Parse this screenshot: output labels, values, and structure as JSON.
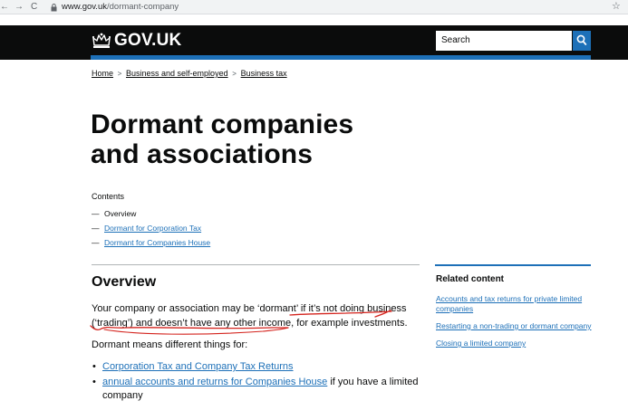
{
  "browser": {
    "back_icon": "←",
    "forward_icon": "→",
    "reload_icon": "C",
    "url_host": "www.gov.uk",
    "url_path": "/dormant-company",
    "star_icon": "☆"
  },
  "header": {
    "logo_text": "GOV.UK",
    "search_placeholder": "Search",
    "brand_color": "#1d70b8"
  },
  "breadcrumb": {
    "items": [
      "Home",
      "Business and self-employed",
      "Business tax"
    ],
    "separator": ">"
  },
  "page": {
    "title": "Dormant companies and associations"
  },
  "contents": {
    "heading": "Contents",
    "items": [
      "Overview",
      "Dormant for Corporation Tax",
      "Dormant for Companies House"
    ]
  },
  "overview": {
    "heading": "Overview",
    "para1_a": "Your company or association may be ‘dormant’ ",
    "para1_b": "if it’s not doing business",
    "para1_c": "(‘trading’) and doesn’t have any other income",
    "para1_d": ", for example investments.",
    "para2": "Dormant means different things for:",
    "bullet1_link": "Corporation Tax and Company Tax Returns",
    "bullet2_link": "annual accounts and returns for Companies House",
    "bullet2_text": " if you have a limited company"
  },
  "related": {
    "heading": "Related content",
    "links": [
      "Accounts and tax returns for private limited companies",
      "Restarting a non-trading or dormant company",
      "Closing a limited company"
    ]
  }
}
